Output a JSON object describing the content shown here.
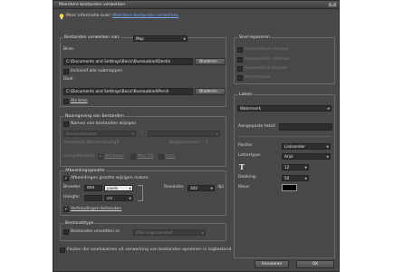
{
  "window": {
    "title": "Meerdere bestanden verwerken",
    "close_glyph": "×"
  },
  "info": {
    "prefix": "Meer informatie over:",
    "link": "Meerdere bestanden verwerken",
    "icon": "lightbulb-icon",
    "icon_color": "#ffd34a"
  },
  "files": {
    "group_title": "Bestanden verwerken van:",
    "source_type": "Map",
    "source_label": "Bron:",
    "source_path": "C:\\Documents and Settings\\Basic\\Bureaublad\\Destin",
    "browse_label": "Bladeren...",
    "include_subfolders": "Inclusief alle submappen",
    "dest_label": "Doel:",
    "dest_path": "C:\\Documents and Settings\\Basic\\Bureaublad\\Persh",
    "same_as_source": "Als bron"
  },
  "naming": {
    "group_title": "Naamgeving van bestanden",
    "rename_files": "Namen van bestanden wijzigen",
    "pattern_1": "Documentnaam",
    "pattern_2": "",
    "plus": "+",
    "example": "Voorbeeld: Mijnbestand.gif",
    "start_number_label": "Beginnummer:",
    "start_number": "1",
    "compat_label": "Compatibiliteit:",
    "compat_windows": "Windows",
    "compat_mac": "Mac OS",
    "compat_unix": "Unix"
  },
  "image_size": {
    "group_title": "Afbeeldingsgrootte",
    "resize_images": "Afbeeldingen grootte wijzigen maken",
    "width_label": "Breedte:",
    "width_value": "800",
    "width_unit": "pixels",
    "height_label": "Hoogte:",
    "height_value": "",
    "height_unit": "cm",
    "resolution_label": "Resolutie:",
    "resolution_value": "300",
    "resolution_unit": "dpi",
    "constrain": "Verhoudingen behouden"
  },
  "file_type": {
    "group_title": "Bestandstype",
    "convert_files": "Bestanden omzetten in:",
    "format": "JPEG Hoge kwaliteit"
  },
  "errors": {
    "log_errors": "Fouten die voorkwamen uit verwerking van bestanden opnemen in logbestand"
  },
  "quick_fix": {
    "group_title": "Snel repareren",
    "auto_levels": "Automatisch niveaus",
    "auto_contrast": "Automatisch contrast",
    "auto_color": "Automatisch kleuren",
    "sharpen": "Verscherpen"
  },
  "labels": {
    "group_title": "Labels",
    "label_type": "Watermerk",
    "custom_text_label": "Aangepaste tekst:",
    "custom_text_value": "",
    "position_label": "Positie:",
    "position_value": "Linksonder",
    "font_label": "Lettertype:",
    "font_value": "Arial",
    "font_icon": "text-size-icon",
    "font_size": "12",
    "opacity_label": "Dekking:",
    "opacity_value": "50",
    "color_label": "Kleur:",
    "color_swatch": "#000000"
  },
  "buttons": {
    "cancel": "Annuleren",
    "ok": "OK"
  }
}
